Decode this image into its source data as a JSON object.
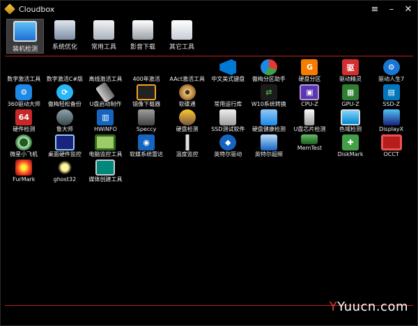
{
  "window": {
    "title": "Cloudbox",
    "menu_glyph": "≡",
    "min_glyph": "–",
    "close_glyph": "✕"
  },
  "toolbar": [
    {
      "label": "装机检测",
      "icon": "monitor-icon",
      "active": true
    },
    {
      "label": "系统优化",
      "icon": "gear-screen-icon",
      "active": false
    },
    {
      "label": "常用工具",
      "icon": "tools-icon",
      "active": false
    },
    {
      "label": "影音下载",
      "icon": "media-download-icon",
      "active": false
    },
    {
      "label": "其它工具",
      "icon": "document-icon",
      "active": false
    }
  ],
  "apps": [
    {
      "label": "数字激活工具",
      "icon": "windows-logo-icon"
    },
    {
      "label": "数字激活C#版",
      "icon": "windows-logo-icon"
    },
    {
      "label": "离线激活工具",
      "icon": "windows-logo-icon"
    },
    {
      "label": "400年激活",
      "icon": "windows-logo-icon"
    },
    {
      "label": "AAct激活工具",
      "icon": "windows-logo-icon"
    },
    {
      "label": "中文美式键盘",
      "icon": "vscode-icon"
    },
    {
      "label": "傲梅分区助手",
      "icon": "disk-pie-icon"
    },
    {
      "label": "硬盘分区",
      "icon": "diskgenius-icon"
    },
    {
      "label": "驱动精灵",
      "icon": "driver-genius-icon"
    },
    {
      "label": "驱动人生7",
      "icon": "driver-life-icon"
    },
    {
      "label": "360驱动大师",
      "icon": "gear-blue-icon"
    },
    {
      "label": "傲梅轻松备份",
      "icon": "backup-icon"
    },
    {
      "label": "U盘启动制作",
      "icon": "usb-stick-icon"
    },
    {
      "label": "镜像下载器",
      "icon": "image-downloader-icon"
    },
    {
      "label": "软碟通",
      "icon": "disc-icon"
    },
    {
      "label": "常用运行库",
      "icon": "windows-logo-icon"
    },
    {
      "label": "W10系统转换",
      "icon": "shuffle-icon"
    },
    {
      "label": "CPU-Z",
      "icon": "cpu-icon"
    },
    {
      "label": "GPU-Z",
      "icon": "gpu-icon"
    },
    {
      "label": "SSD-Z",
      "icon": "ssd-icon"
    },
    {
      "label": "硬件检测",
      "icon": "aida64-icon"
    },
    {
      "label": "鲁大师",
      "icon": "master-lu-icon"
    },
    {
      "label": "HWiNFO",
      "icon": "hwinfo-icon"
    },
    {
      "label": "Speccy",
      "icon": "speccy-icon"
    },
    {
      "label": "硬盘检测",
      "icon": "hdd-check-icon"
    },
    {
      "label": "SSD测试软件",
      "icon": "ssd-test-icon"
    },
    {
      "label": "硬盘健康检测",
      "icon": "hdd-health-icon"
    },
    {
      "label": "U盘芯片检测",
      "icon": "usb-chip-icon"
    },
    {
      "label": "色域检测",
      "icon": "display-icon"
    },
    {
      "label": "DisplayX",
      "icon": "laptop-icon"
    },
    {
      "label": "微星小飞机",
      "icon": "afterburner-icon"
    },
    {
      "label": "桌面硬件监控",
      "icon": "desktop-monitor-icon"
    },
    {
      "label": "电脑监控工具",
      "icon": "green-square-icon"
    },
    {
      "label": "软媒系统雷达",
      "icon": "radar-icon"
    },
    {
      "label": "温度监控",
      "icon": "thermometer-icon"
    },
    {
      "label": "英特尔驱动",
      "icon": "intel-driver-icon"
    },
    {
      "label": "英特尔超频",
      "icon": "intel-oc-icon"
    },
    {
      "label": "MemTest",
      "icon": "memory-icon"
    },
    {
      "label": "DiskMark",
      "icon": "diskmark-icon"
    },
    {
      "label": "OCCT",
      "icon": "occt-icon"
    },
    {
      "label": "FurMark",
      "icon": "furmark-icon"
    },
    {
      "label": "ghost32",
      "icon": "ghost-icon"
    },
    {
      "label": "媒体创建工具",
      "icon": "media-creation-icon"
    }
  ],
  "watermark": {
    "mark": "Y",
    "text": "Yuucn.com"
  },
  "colors": {
    "accent_line": "#c21f1f",
    "background": "#000000",
    "active_tab": "#3a3a3a"
  }
}
